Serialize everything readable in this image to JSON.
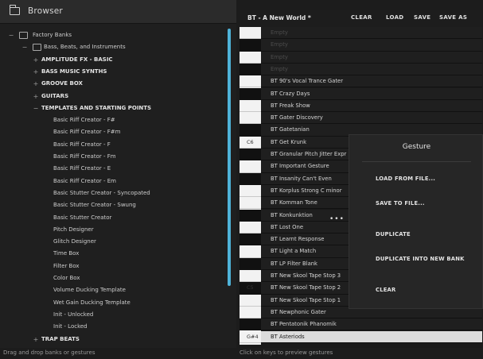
{
  "browser": {
    "title": "Browser",
    "items": [
      {
        "label": "Factory Banks",
        "level": 0,
        "expander": "−",
        "folder": true,
        "bold": false
      },
      {
        "label": "Bass, Beats, and Instruments",
        "level": 1,
        "expander": "−",
        "folder": true,
        "bold": false
      },
      {
        "label": "AMPLITUDE FX - BASIC",
        "level": 2,
        "expander": "+",
        "folder": false,
        "bold": true
      },
      {
        "label": "BASS MUSIC SYNTHS",
        "level": 2,
        "expander": "+",
        "folder": false,
        "bold": true
      },
      {
        "label": "GROOVE BOX",
        "level": 2,
        "expander": "+",
        "folder": false,
        "bold": true
      },
      {
        "label": "GUITARS",
        "level": 2,
        "expander": "+",
        "folder": false,
        "bold": true
      },
      {
        "label": "TEMPLATES AND STARTING POINTS",
        "level": 2,
        "expander": "−",
        "folder": false,
        "bold": true
      },
      {
        "label": "Basic Riff Creator - F#",
        "level": 3,
        "expander": "",
        "folder": false,
        "bold": false
      },
      {
        "label": "Basic Riff Creator - F#m",
        "level": 3,
        "expander": "",
        "folder": false,
        "bold": false
      },
      {
        "label": "Basic Riff Creator - F",
        "level": 3,
        "expander": "",
        "folder": false,
        "bold": false
      },
      {
        "label": "Basic Riff Creator - Fm",
        "level": 3,
        "expander": "",
        "folder": false,
        "bold": false
      },
      {
        "label": "Basic Riff Creator - E",
        "level": 3,
        "expander": "",
        "folder": false,
        "bold": false
      },
      {
        "label": "Basic Riff Creator - Em",
        "level": 3,
        "expander": "",
        "folder": false,
        "bold": false
      },
      {
        "label": "Basic Stutter Creator - Syncopated",
        "level": 3,
        "expander": "",
        "folder": false,
        "bold": false
      },
      {
        "label": "Basic Stutter Creator - Swung",
        "level": 3,
        "expander": "",
        "folder": false,
        "bold": false
      },
      {
        "label": "Basic Stutter Creator",
        "level": 3,
        "expander": "",
        "folder": false,
        "bold": false
      },
      {
        "label": "Pitch Designer",
        "level": 3,
        "expander": "",
        "folder": false,
        "bold": false
      },
      {
        "label": "Glitch Designer",
        "level": 3,
        "expander": "",
        "folder": false,
        "bold": false
      },
      {
        "label": "Time Box",
        "level": 3,
        "expander": "",
        "folder": false,
        "bold": false
      },
      {
        "label": "Filter Box",
        "level": 3,
        "expander": "",
        "folder": false,
        "bold": false
      },
      {
        "label": "Color Box",
        "level": 3,
        "expander": "",
        "folder": false,
        "bold": false
      },
      {
        "label": "Volume Ducking Template",
        "level": 3,
        "expander": "",
        "folder": false,
        "bold": false
      },
      {
        "label": "Wet Gain Ducking Template",
        "level": 3,
        "expander": "",
        "folder": false,
        "bold": false
      },
      {
        "label": "Init - Unlocked",
        "level": 3,
        "expander": "",
        "folder": false,
        "bold": false
      },
      {
        "label": "Init - Locked",
        "level": 3,
        "expander": "",
        "folder": false,
        "bold": false
      },
      {
        "label": "TRAP BEATS",
        "level": 2,
        "expander": "+",
        "folder": false,
        "bold": true
      }
    ],
    "footer": "Drag and drop banks or gestures"
  },
  "bank": {
    "title": "BT - A New World *",
    "buttons": {
      "clear": "CLEAR",
      "load": "LOAD",
      "save": "SAVE",
      "save_as": "SAVE AS"
    },
    "slots": [
      "Empty",
      "Empty",
      "Empty",
      "Empty",
      "BT 90's Vocal Trance Gater",
      "BT Crazy Days",
      "BT Freak Show",
      "BT Gater Discovery",
      "BT Gatetanian",
      "BT Get Krunk",
      "BT Granular Pitch Jitter Expr",
      "BT Important Gesture",
      "BT Insanity Can't Even",
      "BT Korplus Strong C minor",
      "BT Komman Tone",
      "BT Konkunktion",
      "BT Lost One",
      "BT Learnt Response",
      "BT Light a Match",
      "BT LP Filter Blank",
      "BT New Skool Tape Stop 3",
      "BT New Skool Tape Stop 2",
      "BT New Skool Tape Stop 1",
      "BT Newphonic Gater",
      "BT Pentatonik Phanomik",
      "BT Asteriods"
    ],
    "keys": [
      "white",
      "black",
      "white",
      "black",
      "white",
      "black",
      "white",
      "white",
      "black",
      "white",
      "black",
      "white",
      "black",
      "white",
      "white",
      "black",
      "white",
      "black",
      "white",
      "black",
      "white",
      "black",
      "white",
      "white",
      "black",
      "white"
    ],
    "key_labels": {
      "9": "C6",
      "21": "C5",
      "25": "G#4"
    },
    "selected_index": 25,
    "more_dots": "•••",
    "footer": "Click on keys to preview gestures"
  },
  "context_menu": {
    "title": "Gesture",
    "items": [
      "LOAD FROM FILE...",
      "SAVE TO FILE...",
      "DUPLICATE",
      "DUPLICATE INTO NEW BANK",
      "CLEAR"
    ]
  },
  "colors": {
    "accent": "#4fb3d9"
  }
}
